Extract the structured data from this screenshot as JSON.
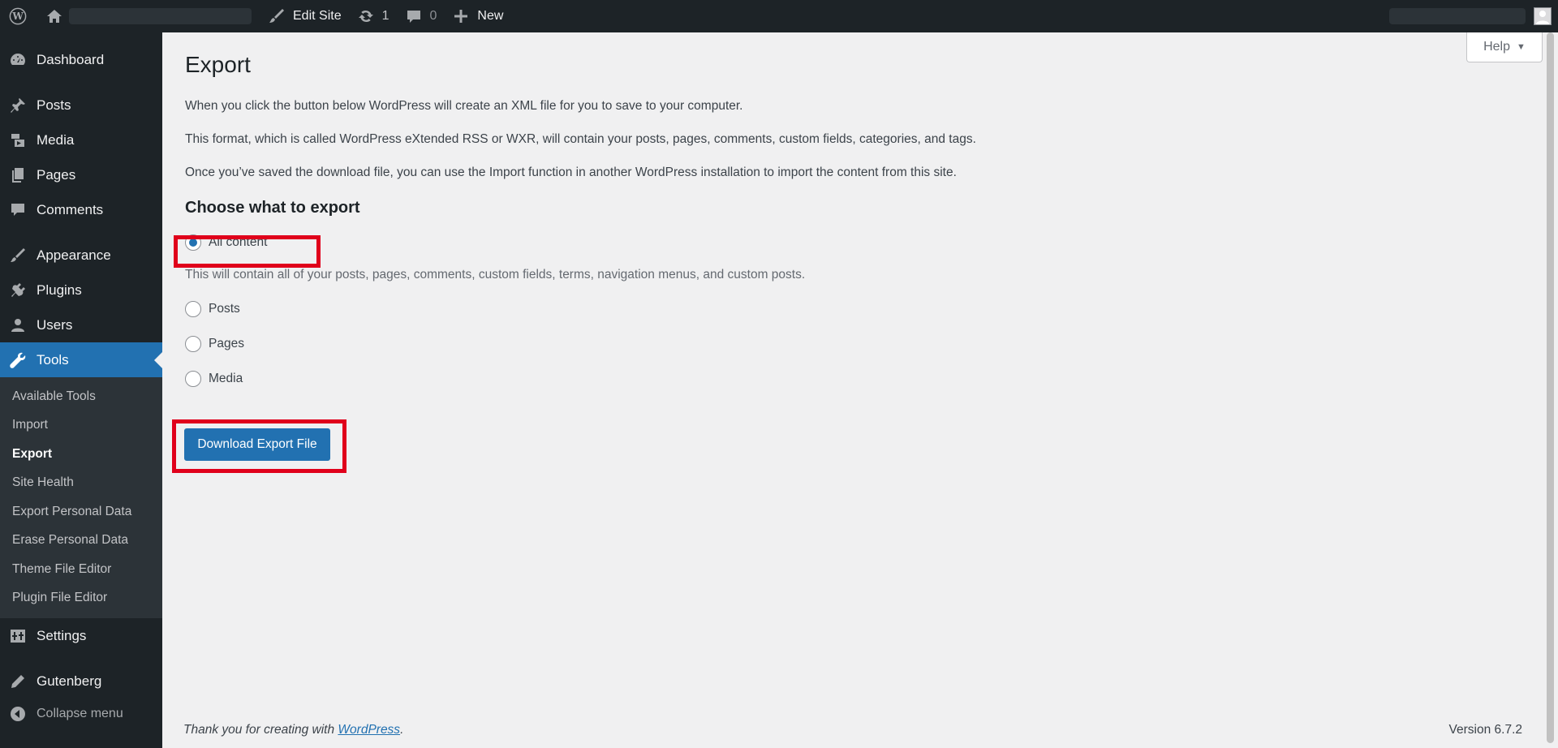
{
  "adminbar": {
    "edit_site": "Edit Site",
    "updates_count": "1",
    "comments_count": "0",
    "new_label": "New"
  },
  "sidebar": {
    "items": [
      {
        "label": "Dashboard",
        "icon": "dashboard-icon"
      },
      {
        "label": "Posts",
        "icon": "pin-icon"
      },
      {
        "label": "Media",
        "icon": "media-icon"
      },
      {
        "label": "Pages",
        "icon": "pages-icon"
      },
      {
        "label": "Comments",
        "icon": "comment-icon"
      },
      {
        "label": "Appearance",
        "icon": "brush-icon"
      },
      {
        "label": "Plugins",
        "icon": "plugin-icon"
      },
      {
        "label": "Users",
        "icon": "user-icon"
      },
      {
        "label": "Tools",
        "icon": "wrench-icon"
      },
      {
        "label": "Settings",
        "icon": "settings-icon"
      },
      {
        "label": "Gutenberg",
        "icon": "pencil-icon"
      }
    ],
    "tools_submenu": [
      "Available Tools",
      "Import",
      "Export",
      "Site Health",
      "Export Personal Data",
      "Erase Personal Data",
      "Theme File Editor",
      "Plugin File Editor"
    ],
    "collapse_label": "Collapse menu"
  },
  "main": {
    "help_label": "Help",
    "title": "Export",
    "paragraphs": [
      "When you click the button below WordPress will create an XML file for you to save to your computer.",
      "This format, which is called WordPress eXtended RSS or WXR, will contain your posts, pages, comments, custom fields, categories, and tags.",
      "Once you’ve saved the download file, you can use the Import function in another WordPress installation to import the content from this site."
    ],
    "section_title": "Choose what to export",
    "options": [
      "All content",
      "Posts",
      "Pages",
      "Media"
    ],
    "selected_option": "All content",
    "all_content_desc": "This will contain all of your posts, pages, comments, custom fields, terms, navigation menus, and custom posts.",
    "download_button": "Download Export File"
  },
  "footer": {
    "thanks_prefix": "Thank you for creating with ",
    "thanks_link": "WordPress",
    "thanks_suffix": ".",
    "version": "Version 6.7.2"
  },
  "colors": {
    "adminbar_bg": "#1d2327",
    "accent": "#2271b1",
    "highlight": "#e0001b",
    "content_bg": "#f0f0f1"
  }
}
